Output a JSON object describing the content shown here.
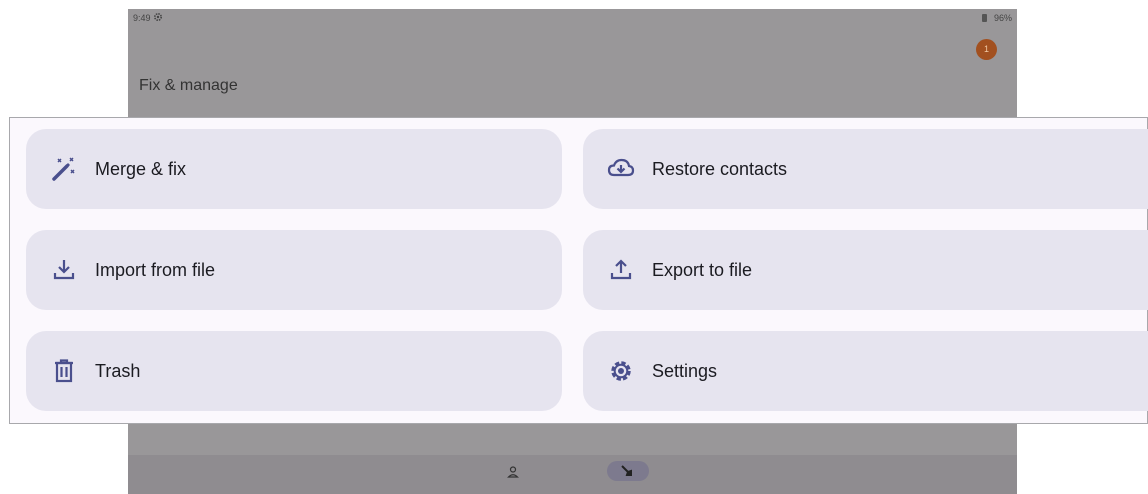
{
  "status_bar": {
    "time": "9:49",
    "battery": "96%"
  },
  "header": {
    "title": "Fix & manage",
    "avatar_initial": "1"
  },
  "actions": [
    {
      "label": "Merge & fix",
      "icon": "magic-wand-icon"
    },
    {
      "label": "Restore contacts",
      "icon": "cloud-download-icon"
    },
    {
      "label": "Import from file",
      "icon": "download-icon"
    },
    {
      "label": "Export to file",
      "icon": "upload-icon"
    },
    {
      "label": "Trash",
      "icon": "trash-icon"
    },
    {
      "label": "Settings",
      "icon": "gear-icon"
    }
  ],
  "colors": {
    "accent": "#4a4f8d",
    "card": "#e6e4ef",
    "panel": "#fbf8fd",
    "scrim": "#999799"
  }
}
